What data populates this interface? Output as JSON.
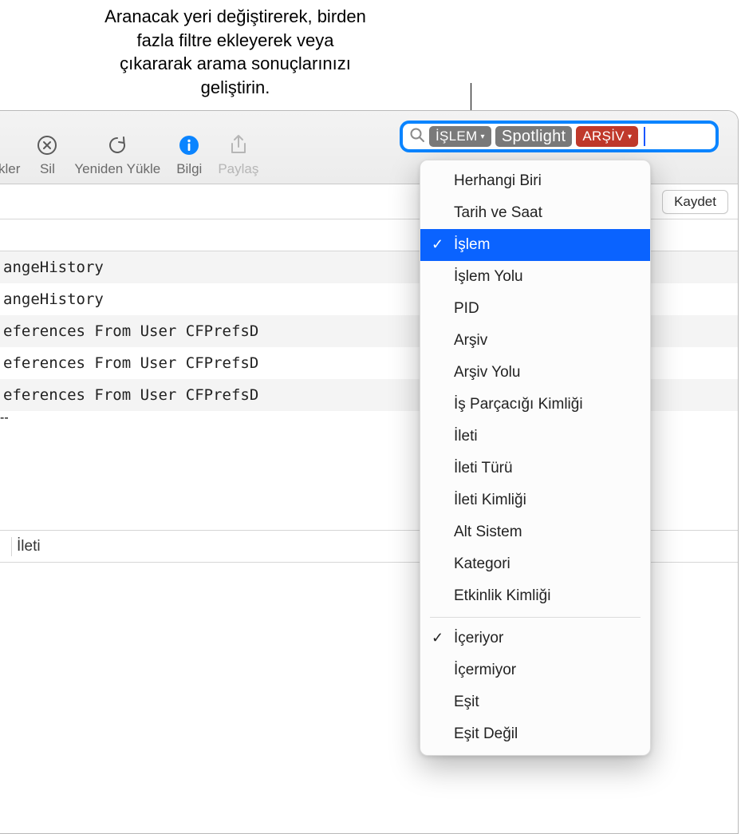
{
  "callout": {
    "text": "Aranacak yeri değiştirerek, birden fazla filtre ekleyerek veya çıkararak arama sonuçlarınızı geliştirin."
  },
  "toolbar": {
    "items": [
      {
        "name": "kler",
        "label": "kler",
        "icon": ""
      },
      {
        "name": "sil",
        "label": "Sil",
        "icon": "close-circle"
      },
      {
        "name": "yeniden-yukle",
        "label": "Yeniden Yükle",
        "icon": "reload"
      },
      {
        "name": "bilgi",
        "label": "Bilgi",
        "icon": "info"
      },
      {
        "name": "paylas",
        "label": "Paylaş",
        "icon": "share",
        "disabled": true
      }
    ]
  },
  "search": {
    "token_process_label": "İŞLEM",
    "token_text": "Spotlight",
    "token_archive_label": "ARŞİV"
  },
  "save_button_label": "Kaydet",
  "log_rows": [
    "angeHistory",
    "angeHistory",
    "eferences From User CFPrefsD",
    "eferences From User CFPrefsD",
    "eferences From User CFPrefsD"
  ],
  "detail_header": {
    "label": "İleti",
    "dashes": "--"
  },
  "dropdown": {
    "group1": [
      {
        "label": "Herhangi Biri",
        "checked": false,
        "selected": false
      },
      {
        "label": "Tarih ve Saat",
        "checked": false,
        "selected": false
      },
      {
        "label": "İşlem",
        "checked": true,
        "selected": true
      },
      {
        "label": "İşlem Yolu",
        "checked": false,
        "selected": false
      },
      {
        "label": "PID",
        "checked": false,
        "selected": false
      },
      {
        "label": "Arşiv",
        "checked": false,
        "selected": false
      },
      {
        "label": "Arşiv Yolu",
        "checked": false,
        "selected": false
      },
      {
        "label": "İş Parçacığı Kimliği",
        "checked": false,
        "selected": false
      },
      {
        "label": "İleti",
        "checked": false,
        "selected": false
      },
      {
        "label": "İleti Türü",
        "checked": false,
        "selected": false
      },
      {
        "label": "İleti Kimliği",
        "checked": false,
        "selected": false
      },
      {
        "label": "Alt Sistem",
        "checked": false,
        "selected": false
      },
      {
        "label": "Kategori",
        "checked": false,
        "selected": false
      },
      {
        "label": "Etkinlik Kimliği",
        "checked": false,
        "selected": false
      }
    ],
    "group2": [
      {
        "label": "İçeriyor",
        "checked": true,
        "selected": false
      },
      {
        "label": "İçermiyor",
        "checked": false,
        "selected": false
      },
      {
        "label": "Eşit",
        "checked": false,
        "selected": false
      },
      {
        "label": "Eşit Değil",
        "checked": false,
        "selected": false
      }
    ]
  }
}
